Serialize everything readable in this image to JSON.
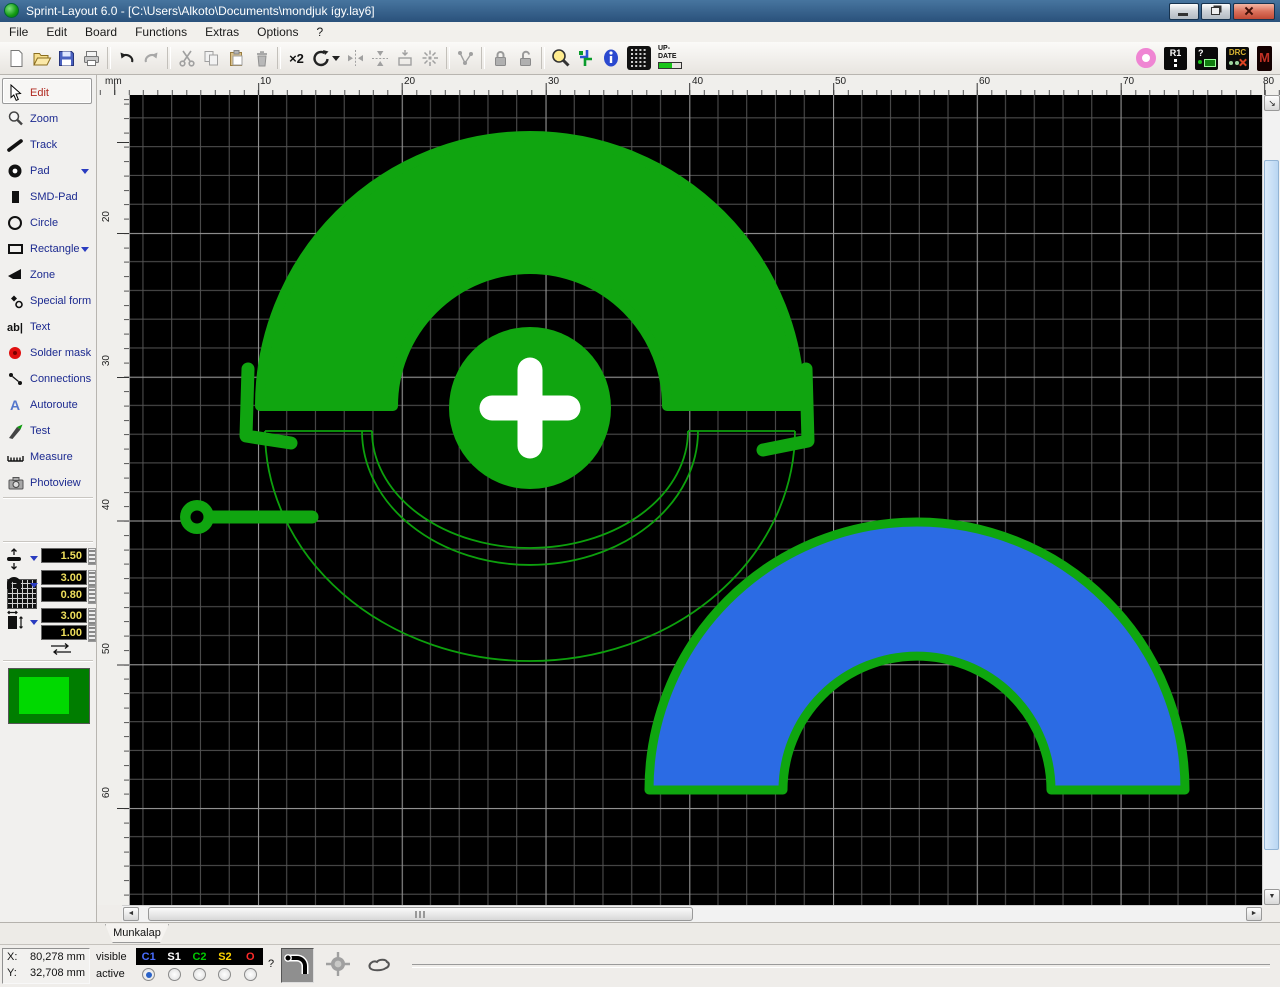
{
  "window": {
    "title": "Sprint-Layout 6.0 - [C:\\Users\\Alkoto\\Documents\\mondjuk így.lay6]"
  },
  "menu": {
    "items": [
      {
        "label": "File"
      },
      {
        "label": "Edit"
      },
      {
        "label": "Board"
      },
      {
        "label": "Functions"
      },
      {
        "label": "Extras"
      },
      {
        "label": "Options"
      },
      {
        "label": "?"
      }
    ]
  },
  "toolbar": {
    "duplicate_label": "×2",
    "update_label_top": "UP-",
    "update_label_bottom": "DATE",
    "badge_r1": "R1",
    "badge_help": "?",
    "badge_drc": "DRC",
    "badge_m": "M",
    "icons": [
      "new",
      "open",
      "save",
      "print",
      "undo",
      "redo",
      "cut",
      "copy",
      "paste",
      "delete",
      "duplicate-x2",
      "rotate",
      "mirror-horizontal",
      "mirror-vertical",
      "align",
      "explode",
      "connections",
      "lock",
      "unlock",
      "zoom-magnifier",
      "fit-view",
      "info",
      "raster-grid",
      "update"
    ]
  },
  "sidebar": {
    "tools": [
      {
        "label": "Edit"
      },
      {
        "label": "Zoom"
      },
      {
        "label": "Track"
      },
      {
        "label": "Pad"
      },
      {
        "label": "SMD-Pad"
      },
      {
        "label": "Circle"
      },
      {
        "label": "Rectangle"
      },
      {
        "label": "Zone"
      },
      {
        "label": "Special form"
      },
      {
        "label": "Text"
      },
      {
        "label": "Solder mask"
      },
      {
        "label": "Connections"
      },
      {
        "label": "Autoroute"
      },
      {
        "label": "Test"
      },
      {
        "label": "Measure"
      },
      {
        "label": "Photoview"
      }
    ],
    "selected_tool": "Edit",
    "grid_value": "2 mm",
    "params": {
      "track_width": "1.50",
      "pad_diameter": "3.00",
      "pad_drill": "0.80",
      "smd_width": "3.00",
      "smd_height": "1.00"
    }
  },
  "rulers": {
    "unit": "mm",
    "horizontal": [
      "10",
      "20",
      "30",
      "40",
      "50",
      "60",
      "70",
      "80"
    ],
    "vertical": [
      "20",
      "30",
      "40",
      "50",
      "60"
    ]
  },
  "scrollbar": {
    "corner_arrow": "↘",
    "left_arrow": "◄",
    "right_arrow": "►",
    "down_arrow": "▼"
  },
  "tabs": {
    "sheet": "Munkalap"
  },
  "statusbar": {
    "x_label": "X:",
    "x_value": "80,278 mm",
    "y_label": "Y:",
    "y_value": "32,708 mm",
    "visible_label": "visible",
    "active_label": "active",
    "layers": [
      {
        "name": "C1",
        "color": "#4a6eff"
      },
      {
        "name": "S1",
        "color": "#ffffff"
      },
      {
        "name": "C2",
        "color": "#00c800"
      },
      {
        "name": "S2",
        "color": "#ffd400"
      },
      {
        "name": "O",
        "color": "#ff2a2a"
      }
    ],
    "active_layer": "C1",
    "help_label": "?"
  },
  "colors": {
    "canvas_background": "#000000",
    "grid_minor": "#545454",
    "grid_major": "#949494",
    "copper_green": "#10a510",
    "copper_blue": "#2b6be4",
    "pad_cross": "#ffffff",
    "swatch_outer": "#007d00",
    "swatch_inner": "#00d900"
  }
}
